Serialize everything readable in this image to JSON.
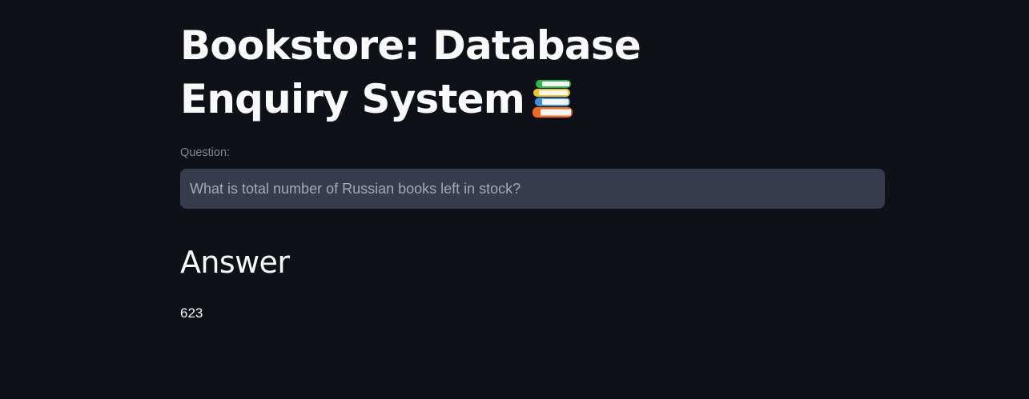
{
  "page": {
    "title": "Bookstore: Database Enquiry System",
    "title_icon": "books-icon"
  },
  "question": {
    "label": "Question:",
    "placeholder": "What is total number of Russian books left in stock?",
    "value": ""
  },
  "answer": {
    "heading": "Answer",
    "value": "623"
  },
  "colors": {
    "background": "#0e1117",
    "text": "#fafafa",
    "input_background": "#363c4e",
    "label": "#808495"
  }
}
